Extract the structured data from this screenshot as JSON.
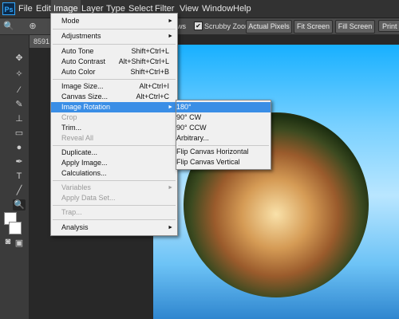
{
  "app": {
    "logo": "Ps"
  },
  "menubar": {
    "items": [
      "File",
      "Edit",
      "Image",
      "Layer",
      "Type",
      "Select",
      "Filter",
      "View",
      "Window",
      "Help"
    ]
  },
  "options": {
    "windows_partial": "ws",
    "scrubby_checked": "✔",
    "scrubby_label": "Scrubby Zoom",
    "actual_pixels": "Actual Pixels",
    "fit_screen": "Fit Screen",
    "fill_screen": "Fill Screen",
    "print_size": "Print"
  },
  "document": {
    "tab_label": "8591"
  },
  "image_menu": {
    "items": [
      {
        "label": "Mode",
        "arrow": "►",
        "shortcut": ""
      },
      {
        "label": "Adjustments",
        "arrow": "►",
        "shortcut": ""
      },
      {
        "label": "Auto Tone",
        "shortcut": "Shift+Ctrl+L"
      },
      {
        "label": "Auto Contrast",
        "shortcut": "Alt+Shift+Ctrl+L"
      },
      {
        "label": "Auto Color",
        "shortcut": "Shift+Ctrl+B"
      },
      {
        "label": "Image Size...",
        "shortcut": "Alt+Ctrl+I"
      },
      {
        "label": "Canvas Size...",
        "shortcut": "Alt+Ctrl+C"
      },
      {
        "label": "Image Rotation",
        "arrow": "►",
        "shortcut": ""
      },
      {
        "label": "Crop",
        "shortcut": ""
      },
      {
        "label": "Trim...",
        "shortcut": ""
      },
      {
        "label": "Reveal All",
        "shortcut": ""
      },
      {
        "label": "Duplicate...",
        "shortcut": ""
      },
      {
        "label": "Apply Image...",
        "shortcut": ""
      },
      {
        "label": "Calculations...",
        "shortcut": ""
      },
      {
        "label": "Variables",
        "arrow": "►",
        "shortcut": ""
      },
      {
        "label": "Apply Data Set...",
        "shortcut": ""
      },
      {
        "label": "Trap...",
        "shortcut": ""
      },
      {
        "label": "Analysis",
        "arrow": "►",
        "shortcut": ""
      }
    ]
  },
  "rotation_submenu": {
    "items": [
      "180°",
      "90° CW",
      "90° CCW",
      "Arbitrary...",
      "Flip Canvas Horizontal",
      "Flip Canvas Vertical"
    ]
  },
  "colors": {
    "menu_highlight": "#3a8ee6",
    "menu_bg": "#f0f0f0",
    "chrome": "#323232"
  }
}
